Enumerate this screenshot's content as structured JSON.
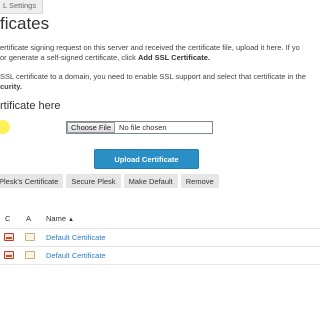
{
  "breadcrumb": {
    "text": "L Settings"
  },
  "page": {
    "title": "ficates",
    "description_lines": [
      "ertificate signing request on this server and received the certificate file, upload it here. If yo",
      "or generate a self-signed certificate, click ",
      "SSL certificate to a domain, you need to enable SSL support and select that certificate in the",
      "curity."
    ],
    "add_ssl_label": "Add SSL Certificate.",
    "section_heading": "rtificate here"
  },
  "upload": {
    "choose_file_label": "Choose File",
    "file_status": "No file chosen",
    "upload_button_label": "Upload Certificate"
  },
  "toolbar": {
    "buttons": [
      "Plesk's Certificate",
      "Secure Plesk",
      "Make Default",
      "Remove"
    ]
  },
  "table": {
    "headers": {
      "c": "C",
      "a": "A",
      "name": "Name"
    },
    "sort_indicator": "▲",
    "rows": [
      {
        "name": "Default Certificate"
      },
      {
        "name": "Default Certificate"
      }
    ]
  },
  "colors": {
    "accent": "#2a8fc4",
    "link": "#2a7fbf",
    "toolbar_bg": "#e6e6e6",
    "cursor_highlight": "#fff03c"
  },
  "icons": {
    "c_column": "certificate-icon",
    "a_column": "certificate-pending-icon"
  }
}
